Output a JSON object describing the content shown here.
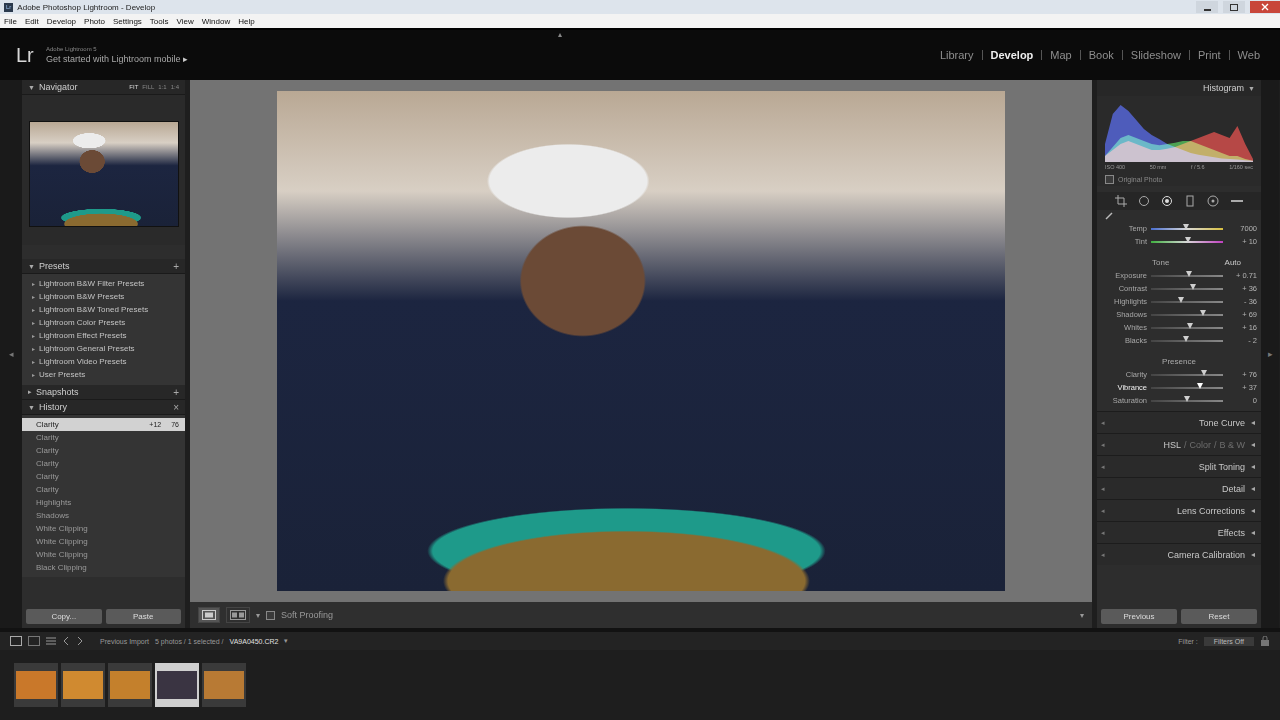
{
  "window": {
    "title": "Adobe Photoshop Lightroom - Develop",
    "app_badge": "Lr"
  },
  "menu": [
    "File",
    "Edit",
    "Develop",
    "Photo",
    "Settings",
    "Tools",
    "View",
    "Window",
    "Help"
  ],
  "identity": {
    "logo": "Lr",
    "product": "Adobe Lightroom 5",
    "mobile": "Get started with Lightroom mobile",
    "mobile_arrow": "▸",
    "top_arrow": "▴"
  },
  "modules": [
    {
      "label": "Library",
      "selected": false
    },
    {
      "label": "Develop",
      "selected": true
    },
    {
      "label": "Map",
      "selected": false
    },
    {
      "label": "Book",
      "selected": false
    },
    {
      "label": "Slideshow",
      "selected": false
    },
    {
      "label": "Print",
      "selected": false
    },
    {
      "label": "Web",
      "selected": false
    }
  ],
  "edge_arrows": {
    "left": "◂",
    "right": "▸"
  },
  "left_panel": {
    "navigator": {
      "title": "Navigator",
      "arrow": "▼",
      "zoom": [
        {
          "label": "FIT",
          "selected": true
        },
        {
          "label": "FILL",
          "selected": false
        },
        {
          "label": "1:1",
          "selected": false
        },
        {
          "label": "1:4",
          "selected": false
        }
      ]
    },
    "presets": {
      "title": "Presets",
      "arrow": "▼",
      "action": "+",
      "item_arrow": "▸",
      "items": [
        "Lightroom B&W Filter Presets",
        "Lightroom B&W Presets",
        "Lightroom B&W Toned Presets",
        "Lightroom Color Presets",
        "Lightroom Effect Presets",
        "Lightroom General Presets",
        "Lightroom Video Presets",
        "User Presets"
      ]
    },
    "snapshots": {
      "title": "Snapshots",
      "arrow": "▸",
      "action": "+"
    },
    "history": {
      "title": "History",
      "arrow": "▼",
      "action": "×",
      "items": [
        {
          "name": "Clarity",
          "from": "+12",
          "to": "76",
          "selected": true
        },
        {
          "name": "Clarity",
          "selected": false
        },
        {
          "name": "Clarity",
          "selected": false
        },
        {
          "name": "Clarity",
          "selected": false
        },
        {
          "name": "Clarity",
          "selected": false
        },
        {
          "name": "Clarity",
          "selected": false
        },
        {
          "name": "Highlights",
          "selected": false
        },
        {
          "name": "Shadows",
          "selected": false
        },
        {
          "name": "White Clipping",
          "selected": false
        },
        {
          "name": "White Clipping",
          "selected": false
        },
        {
          "name": "White Clipping",
          "selected": false
        },
        {
          "name": "Black Clipping",
          "selected": false
        }
      ]
    },
    "buttons": [
      "Copy...",
      "Paste"
    ]
  },
  "toolbar": {
    "soft_proofing": {
      "label": "Soft Proofing",
      "checked": false
    },
    "arrow": "▾"
  },
  "right_panel": {
    "histogram": {
      "title": "Histogram",
      "arrow": "▼",
      "series": [
        {
          "name": "red",
          "color": "#e0302c",
          "values": [
            0.1,
            0.2,
            0.3,
            0.35,
            0.3,
            0.25,
            0.2,
            0.2,
            0.22,
            0.25,
            0.3,
            0.35,
            0.4,
            0.45,
            0.5,
            0.45,
            0.4,
            0.6,
            0.3,
            0.05
          ]
        },
        {
          "name": "green",
          "color": "#38c040",
          "values": [
            0.1,
            0.25,
            0.4,
            0.45,
            0.4,
            0.35,
            0.3,
            0.28,
            0.3,
            0.32,
            0.35,
            0.35,
            0.3,
            0.25,
            0.2,
            0.15,
            0.1,
            0.1,
            0.05,
            0.02
          ]
        },
        {
          "name": "blue",
          "color": "#3a50e8",
          "values": [
            0.3,
            0.8,
            0.95,
            0.85,
            0.7,
            0.55,
            0.45,
            0.38,
            0.3,
            0.25,
            0.2,
            0.15,
            0.12,
            0.1,
            0.08,
            0.06,
            0.05,
            0.04,
            0.03,
            0.02
          ]
        }
      ],
      "exif": [
        "ISO 400",
        "50 mm",
        "f / 5.6",
        "1/160 sec"
      ],
      "original_photo": {
        "label": "Original Photo",
        "checked": false
      }
    },
    "basic": {
      "wb": [
        {
          "label": "Temp",
          "value": "7000",
          "level": 0.48,
          "kind": "temp",
          "active": false
        },
        {
          "label": "Tint",
          "value": "+ 10",
          "level": 0.52,
          "kind": "tint",
          "active": false
        }
      ],
      "tone": {
        "label": "Tone",
        "auto": "Auto"
      },
      "tone_sliders": [
        {
          "label": "Exposure",
          "value": "+ 0.71",
          "level": 0.53,
          "kind": "plain",
          "active": false
        },
        {
          "label": "Contrast",
          "value": "+ 36",
          "level": 0.59,
          "kind": "plain",
          "active": false
        },
        {
          "label": "Highlights",
          "value": "- 36",
          "level": 0.41,
          "kind": "plain",
          "active": false
        },
        {
          "label": "Shadows",
          "value": "+ 69",
          "level": 0.72,
          "kind": "plain",
          "active": false
        },
        {
          "label": "Whites",
          "value": "+ 16",
          "level": 0.54,
          "kind": "plain",
          "active": false
        },
        {
          "label": "Blacks",
          "value": "- 2",
          "level": 0.49,
          "kind": "plain",
          "active": false
        }
      ],
      "presence": {
        "label": "Presence",
        "sliders": [
          {
            "label": "Clarity",
            "value": "+ 76",
            "level": 0.74,
            "kind": "plain",
            "active": false
          },
          {
            "label": "Vibrance",
            "value": "+ 37",
            "level": 0.68,
            "kind": "plain",
            "active": true
          },
          {
            "label": "Saturation",
            "value": "0",
            "level": 0.5,
            "kind": "plain",
            "active": false
          }
        ]
      }
    },
    "sections": [
      {
        "arrow": "◂",
        "parts": [
          {
            "label": "Tone Curve",
            "selected": true
          }
        ]
      },
      {
        "arrow": "◂",
        "parts": [
          {
            "label": "HSL",
            "selected": true
          },
          {
            "label": "/",
            "selected": false
          },
          {
            "label": "Color",
            "selected": false
          },
          {
            "label": "/",
            "selected": false
          },
          {
            "label": "B & W",
            "selected": false
          }
        ]
      },
      {
        "arrow": "◂",
        "parts": [
          {
            "label": "Split Toning",
            "selected": true
          }
        ]
      },
      {
        "arrow": "◂",
        "parts": [
          {
            "label": "Detail",
            "selected": true
          }
        ]
      },
      {
        "arrow": "◂",
        "parts": [
          {
            "label": "Lens Corrections",
            "selected": true
          }
        ]
      },
      {
        "arrow": "◂",
        "parts": [
          {
            "label": "Effects",
            "selected": true
          }
        ]
      },
      {
        "arrow": "◂",
        "parts": [
          {
            "label": "Camera Calibration",
            "selected": true
          }
        ]
      }
    ],
    "buttons": [
      "Previous",
      "Reset"
    ]
  },
  "filmstrip": {
    "source": "Previous Import",
    "count": "5 photos / 1 selected /",
    "file": "VA9A0450.CR2",
    "file_arrow": "▾",
    "filter_label": "Filter :",
    "filter_value": "Filters Off",
    "thumbnails": [
      {
        "selected": false,
        "color": "#c9782a"
      },
      {
        "selected": false,
        "color": "#d08a30"
      },
      {
        "selected": false,
        "color": "#c4802c"
      },
      {
        "selected": true,
        "color": "#3a3442"
      },
      {
        "selected": false,
        "color": "#b87a34"
      }
    ]
  }
}
